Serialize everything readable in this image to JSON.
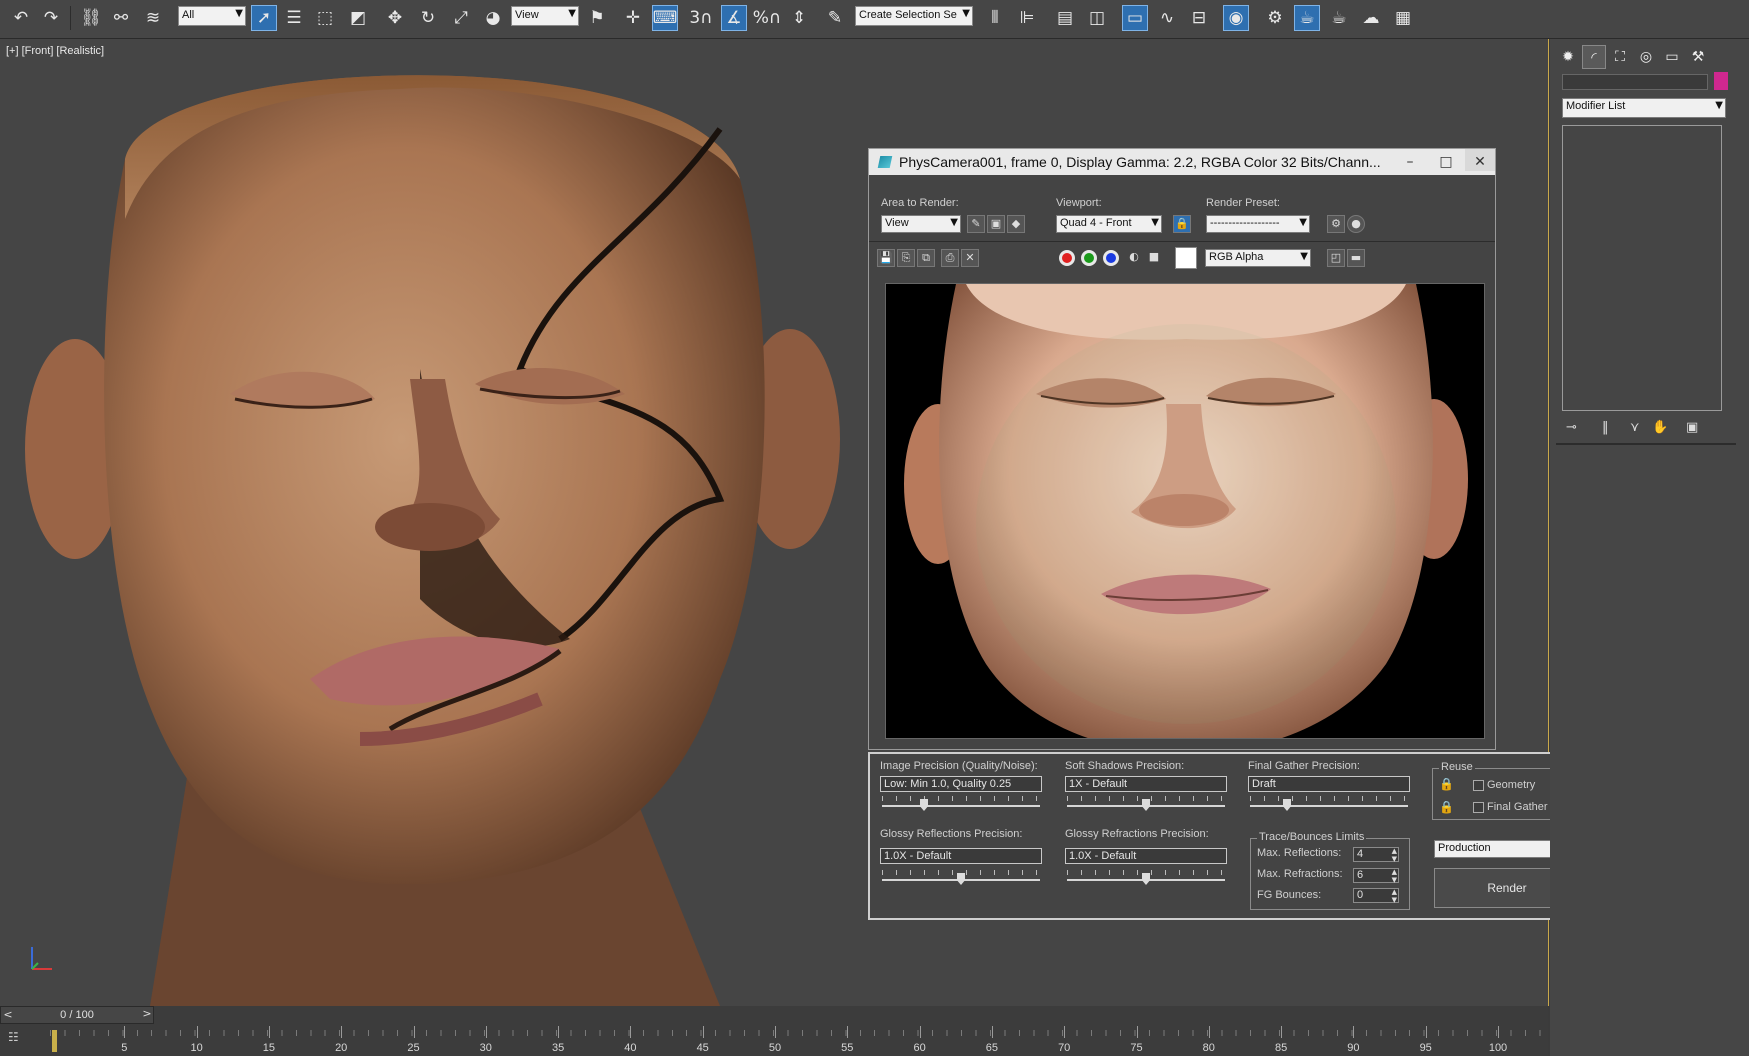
{
  "toolbar": {
    "selection_filter": "All",
    "reference_coord": "View",
    "snap_number": "3",
    "percent_label": "%",
    "named_selection": "Create Selection Se",
    "icons": [
      "undo-icon",
      "redo-icon",
      "link-icon",
      "unlink-icon",
      "bind-spacewarp-icon",
      "select-object-icon",
      "select-by-name-icon",
      "rect-selection-icon",
      "window-crossing-icon",
      "move-icon",
      "rotate-icon",
      "scale-icon",
      "place-icon",
      "pivot-icon",
      "keyboard-shortcut-icon",
      "snap-toggle-icon",
      "angle-snap-icon",
      "percent-snap-icon",
      "spinner-snap-icon",
      "edit-named-selection-icon",
      "mirror-icon",
      "align-icon",
      "scene-explorer-icon",
      "layer-explorer-icon",
      "toggle-ribbon-icon",
      "curve-editor-icon",
      "schematic-view-icon",
      "material-editor-icon",
      "render-setup-icon",
      "rendered-frame-window-icon",
      "render-production-icon",
      "render-iterative-icon",
      "render-in-cloud-icon"
    ]
  },
  "viewport": {
    "label": "[+] [Front] [Realistic]"
  },
  "render_window": {
    "title": "PhysCamera001, frame 0, Display Gamma: 2.2, RGBA Color 32 Bits/Chann...",
    "area_label": "Area to Render:",
    "area_value": "View",
    "viewport_label": "Viewport:",
    "viewport_value": "Quad 4 - Front",
    "preset_label": "Render Preset:",
    "preset_value": "-------------------",
    "channel_value": "RGB Alpha",
    "minimize": "–",
    "maximize": "□",
    "close": "✕"
  },
  "settings": {
    "image_precision_label": "Image Precision (Quality/Noise):",
    "image_precision_value": "Low: Min 1.0, Quality 0.25",
    "image_precision_level": 0.25,
    "soft_shadows_label": "Soft Shadows Precision:",
    "soft_shadows_value": "1X - Default",
    "soft_shadows_level": 0.5,
    "final_gather_label": "Final Gather Precision:",
    "final_gather_value": "Draft",
    "final_gather_level": 0.22,
    "glossy_reflections_label": "Glossy Reflections Precision:",
    "glossy_reflections_value": "1.0X - Default",
    "glossy_reflections_level": 0.5,
    "glossy_refractions_label": "Glossy Refractions Precision:",
    "glossy_refractions_value": "1.0X - Default",
    "glossy_refractions_level": 0.5,
    "reuse_title": "Reuse",
    "reuse_geometry": "Geometry",
    "reuse_final_gather": "Final Gather",
    "trace_title": "Trace/Bounces Limits",
    "max_reflections_label": "Max. Reflections:",
    "max_reflections_value": "4",
    "max_refractions_label": "Max. Refractions:",
    "max_refractions_value": "6",
    "fg_bounces_label": "FG Bounces:",
    "fg_bounces_value": "0",
    "render_mode": "Production",
    "render_button": "Render"
  },
  "command_panel": {
    "modifier_list": "Modifier List",
    "object_color": "#d0288f"
  },
  "timeline": {
    "frame_display": "0 / 100",
    "prev": "<",
    "next": ">",
    "ticks": [
      "5",
      "10",
      "15",
      "20",
      "25",
      "30",
      "35",
      "40",
      "45",
      "50",
      "55",
      "60",
      "65",
      "70",
      "75",
      "80",
      "85",
      "90",
      "95",
      "100"
    ]
  },
  "colors": {
    "accent_active": "#2e6fb0",
    "time_cursor": "#c9b04a"
  }
}
